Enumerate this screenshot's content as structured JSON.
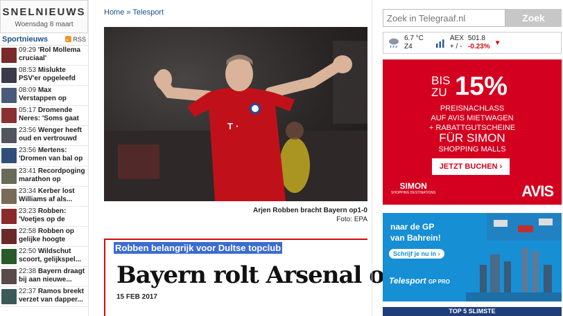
{
  "sidebar": {
    "title": "SNELNIEUWS",
    "date": "Woensdag 8 maart",
    "section_label": "Sportnieuws",
    "rss_label": "RSS",
    "items": [
      {
        "time": "09:29",
        "text": "'Rol Mollema cruciaal'",
        "color": "#7a2a2a"
      },
      {
        "time": "08:53",
        "text": "Mislukte PSV'er opgeleefd",
        "color": "#3a3a4a"
      },
      {
        "time": "08:09",
        "text": "Max Verstappen op",
        "color": "#4a5a7a"
      },
      {
        "time": "05:17",
        "text": "Dromende Neres: 'Soms gaat",
        "color": "#8a3030"
      },
      {
        "time": "23:56",
        "text": "Wenger heeft oud en vertrouwd",
        "color": "#505560"
      },
      {
        "time": "23:56",
        "text": "Mertens: 'Dromen van bal op",
        "color": "#2f4f7a"
      },
      {
        "time": "23:41",
        "text": "Recordpoging marathon op",
        "color": "#6a6a5a"
      },
      {
        "time": "23:34",
        "text": "Kerber lost Williams af als...",
        "color": "#7a6a5a"
      },
      {
        "time": "23:23",
        "text": "Robben: 'Voetjes op de",
        "color": "#8a2a2a"
      },
      {
        "time": "22:58",
        "text": "Robben op gelijke hoogte",
        "color": "#6a2a2a"
      },
      {
        "time": "22:50",
        "text": "Wildschut scoort, gelijkspel...",
        "color": "#2a5a2a"
      },
      {
        "time": "22:38",
        "text": "Bayern draagt bij aan nieuwe...",
        "color": "#5a4a4a"
      },
      {
        "time": "22:37",
        "text": "Ramos breekt verzet van dapper...",
        "color": "#3a5a5a"
      }
    ]
  },
  "main": {
    "breadcrumb": [
      "Home",
      "Telesport"
    ],
    "breadcrumb_sep": "»",
    "caption": "Arjen Robben bracht Bayern op1-0",
    "credit": "Foto: EPA",
    "kicker": "Robben belangrijk voor Dultse topclub",
    "headline": "Bayern rolt Arsenal op",
    "date": "15 FEB 2017"
  },
  "search": {
    "placeholder": "Zoek in Telegraaf.nl",
    "button": "Zoek"
  },
  "ticker": {
    "temp": "6.7 °C",
    "wind": "Z4",
    "index": "AEX",
    "index_label": "+ / -",
    "value": "501.8",
    "change": "-0.23%"
  },
  "ad1": {
    "bis": "BIS",
    "zu": "ZU",
    "percent": "15%",
    "line2": "PREISNACHLASS",
    "line3": "AUF AVIS MIETWAGEN",
    "line4": "+ RABATTGUTSCHEINE",
    "line5": "FÜR SIMON",
    "line6": "SHOPPING MALLS",
    "cta": "JETZT BUCHEN",
    "simon": "SIMON",
    "simon_sub": "SHOPPING DESTINATIONS",
    "avis": "AVIS"
  },
  "ad2": {
    "line1": "naar de GP",
    "line2": "van Bahrein!",
    "cta": "Schrijf je nu in",
    "brand": "Telesport",
    "brand_sub": "GP PRO"
  },
  "ad3": {
    "text": "TOP 5 SLIMSTE"
  }
}
